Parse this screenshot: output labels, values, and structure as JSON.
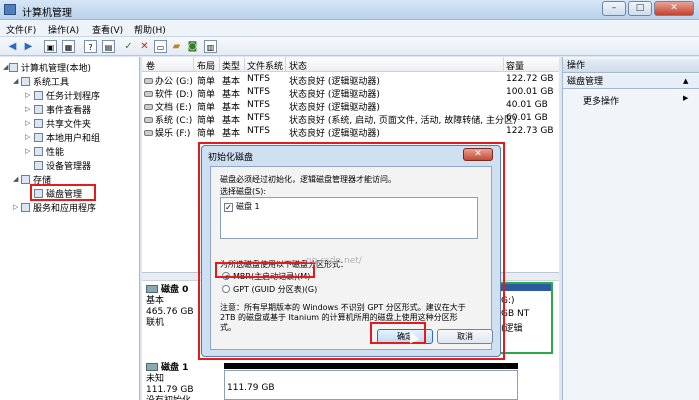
{
  "window": {
    "title": "计算机管理",
    "min": "–",
    "max": "□",
    "close": "✕"
  },
  "menu": [
    "文件(F)",
    "操作(A)",
    "查看(V)",
    "帮助(H)"
  ],
  "tree": {
    "root": "计算机管理(本地)",
    "system_tools": "系统工具",
    "task_scheduler": "任务计划程序",
    "event_viewer": "事件查看器",
    "shared_folders": "共享文件夹",
    "local_users": "本地用户和组",
    "performance": "性能",
    "device_manager": "设备管理器",
    "storage": "存储",
    "disk_management": "磁盘管理",
    "services": "服务和应用程序"
  },
  "columns": [
    "卷",
    "布局",
    "类型",
    "文件系统",
    "状态",
    "容量"
  ],
  "volumes": [
    {
      "name": "办公 (G:)",
      "layout": "简单",
      "type": "基本",
      "fs": "NTFS",
      "status": "状态良好 (逻辑驱动器)",
      "capacity": "122.72 GB"
    },
    {
      "name": "软件 (D:)",
      "layout": "简单",
      "type": "基本",
      "fs": "NTFS",
      "status": "状态良好 (逻辑驱动器)",
      "capacity": "100.01 GB"
    },
    {
      "name": "文档 (E:)",
      "layout": "简单",
      "type": "基本",
      "fs": "NTFS",
      "status": "状态良好 (逻辑驱动器)",
      "capacity": "40.01 GB"
    },
    {
      "name": "系统 (C:)",
      "layout": "简单",
      "type": "基本",
      "fs": "NTFS",
      "status": "状态良好 (系统, 启动, 页面文件, 活动, 故障转储, 主分区)",
      "capacity": "60.01 GB"
    },
    {
      "name": "娱乐 (F:)",
      "layout": "简单",
      "type": "基本",
      "fs": "NTFS",
      "status": "状态良好 (逻辑驱动器)",
      "capacity": "122.73 GB"
    }
  ],
  "disks": [
    {
      "title": "磁盘 0",
      "kind": "基本",
      "size": "465.76 GB",
      "state": "联机"
    },
    {
      "title": "磁盘 1",
      "kind": "未知",
      "size": "111.79 GB",
      "state": "没有初始化"
    }
  ],
  "unalloc_size": "111.79 GB",
  "right_partition": {
    "label": "G:)",
    "size": "GB NT",
    "status": "(逻辑"
  },
  "actions": {
    "header": "操作",
    "group": "磁盘管理",
    "more": "更多操作"
  },
  "dialog": {
    "title": "初始化磁盘",
    "intro": "磁盘必须经过初始化，逻辑磁盘管理器才能访问。",
    "select_label": "选择磁盘(S):",
    "disk_item": "磁盘 1",
    "style_label": "为所选磁盘使用以下磁盘分区形式：",
    "mbr": "MBR(主启动记录)(M)",
    "gpt": "GPT (GUID 分区表)(G)",
    "note1": "注意：所有早期版本的 Windows 不识别 GPT 分区形式。建议在大于",
    "note2": "2TB 的磁盘或基于 Itanium 的计算机所用的磁盘上使用这种分区形",
    "note3": "式。",
    "ok": "确定",
    "cancel": "取消"
  },
  "watermark": "og.csdn.net/"
}
